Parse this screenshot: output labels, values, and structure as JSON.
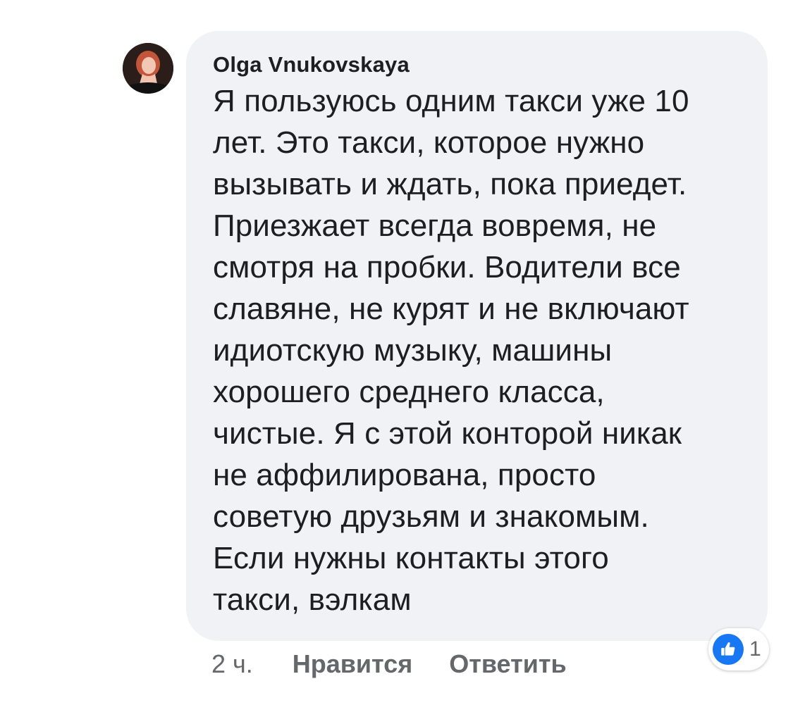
{
  "comment": {
    "author": "Olga Vnukovskaya",
    "text": "Я пользуюсь одним такси уже 10\nлет. Это такси, которое нужно\nвызывать и ждать, пока приедет.\nПриезжает всегда вовремя, не\nсмотря на пробки. Водители все\nславяне, не курят и не включают\nидиотскую музыку,  машины\nхорошего среднего класса,\nчистые. Я с этой конторой никак\nне аффилирована, просто\nсоветую друзьям и знакомым.\nЕсли нужны контакты этого\nтакси, вэлкам"
  },
  "actions": {
    "timestamp": "2 ч.",
    "like_label": "Нравится",
    "reply_label": "Ответить"
  },
  "reactions": {
    "icon": "thumbs-up-icon",
    "count": "1"
  },
  "colors": {
    "bubble": "#f0f2f5",
    "text": "#1c1e21",
    "secondary": "#65676b",
    "like_blue": "#1877f2"
  }
}
